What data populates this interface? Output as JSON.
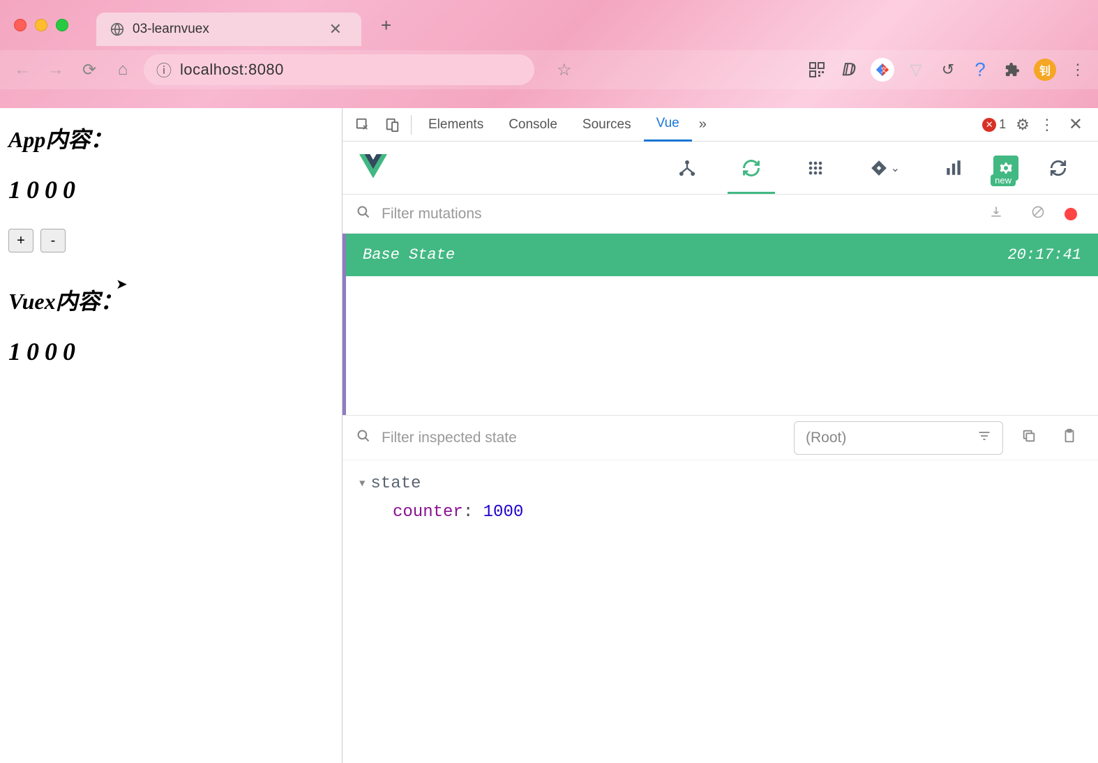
{
  "browser": {
    "tab_title": "03-learnvuex",
    "url": "localhost:8080",
    "avatar_letter": "钊",
    "error_count": "1"
  },
  "page": {
    "heading1": "App内容：",
    "value1": "1000",
    "btn_plus": "+",
    "btn_minus": "-",
    "heading2": "Vuex内容：",
    "value2": "1000"
  },
  "devtools": {
    "tabs": {
      "elements": "Elements",
      "console": "Console",
      "sources": "Sources",
      "vue": "Vue"
    }
  },
  "vue_panel": {
    "filter_mutations_placeholder": "Filter mutations",
    "filter_state_placeholder": "Filter inspected state",
    "root_label": "(Root)",
    "new_badge": "new",
    "mutation": {
      "label": "Base State",
      "time": "20:17:41"
    },
    "state": {
      "root_label": "state",
      "props": [
        {
          "key": "counter",
          "value": "1000"
        }
      ]
    }
  }
}
